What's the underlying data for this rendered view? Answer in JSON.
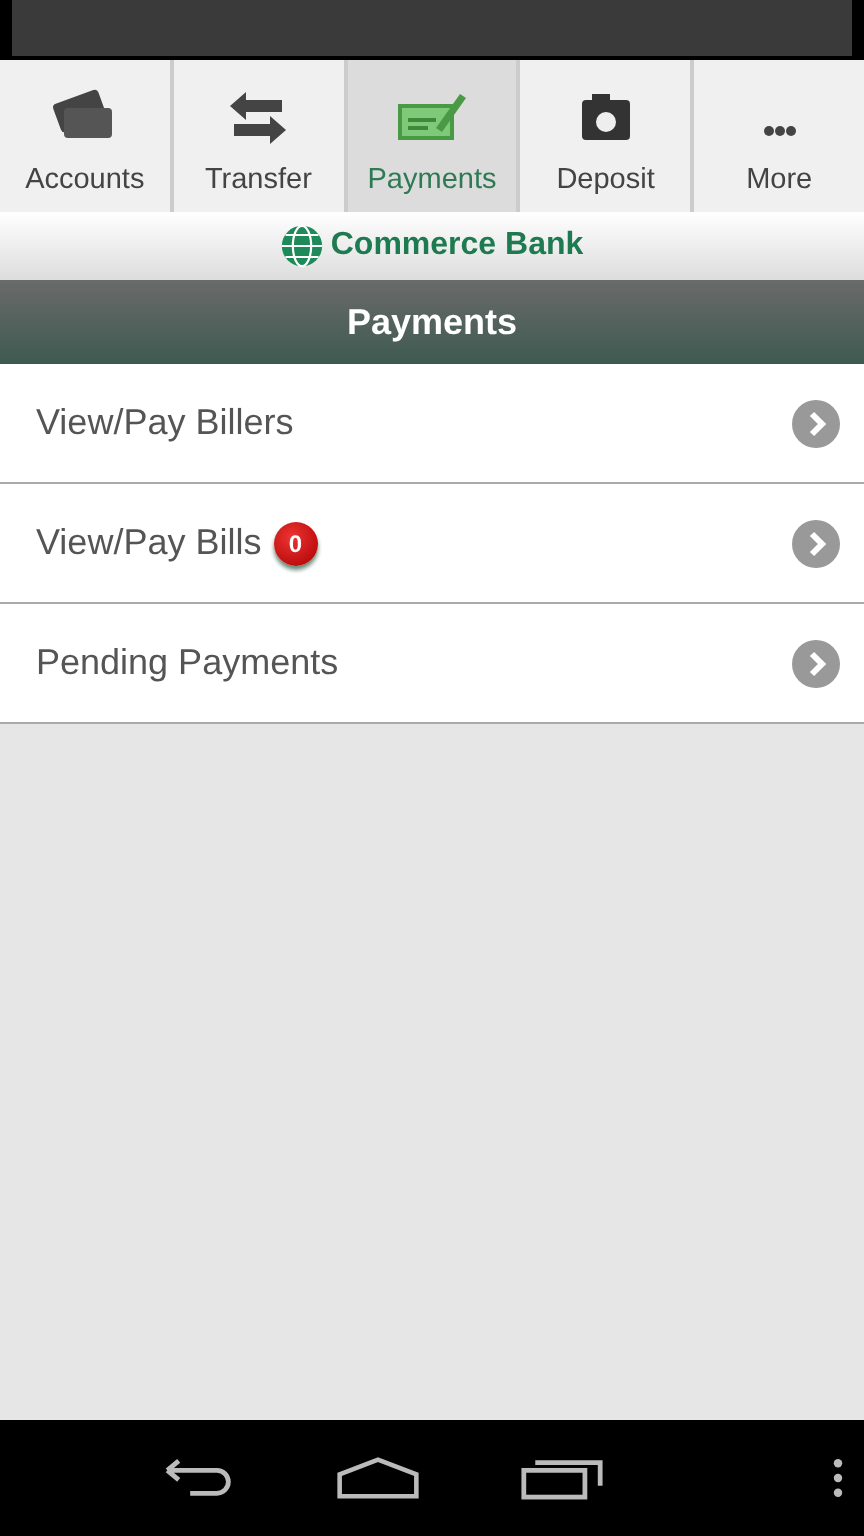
{
  "tabs": [
    {
      "label": "Accounts",
      "kind": "cards",
      "selected": false
    },
    {
      "label": "Transfer",
      "kind": "arrows",
      "selected": false
    },
    {
      "label": "Payments",
      "kind": "check",
      "selected": true
    },
    {
      "label": "Deposit",
      "kind": "camera",
      "selected": false
    },
    {
      "label": "More",
      "kind": "dots",
      "selected": false
    }
  ],
  "logo": {
    "name": "Commerce Bank"
  },
  "header": {
    "title": "Payments"
  },
  "menu": [
    {
      "label": "View/Pay Billers"
    },
    {
      "label": "View/Pay Bills",
      "badge": "0"
    },
    {
      "label": "Pending Payments"
    }
  ]
}
